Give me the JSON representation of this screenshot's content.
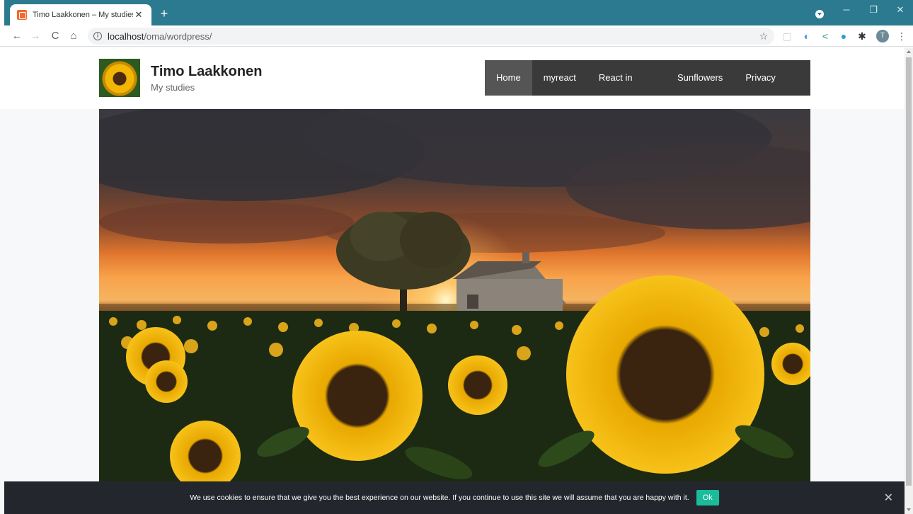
{
  "browser": {
    "tab_title": "Timo Laakkonen – My studies",
    "tab_close": "✕",
    "new_tab": "+",
    "url_host": "localhost",
    "url_path": "/oma/wordpress/",
    "profile_initial": "T",
    "window_controls": {
      "minimize": "─",
      "restore": "❐",
      "close": "✕"
    },
    "nav": {
      "back": "←",
      "forward": "→",
      "reload": "C",
      "home": "⌂"
    },
    "extensions": [
      "star-icon",
      "extension-box-icon",
      "cloud-icon",
      "share-icon",
      "telegram-icon",
      "puzzle-icon"
    ]
  },
  "site": {
    "title": "Timo Laakkonen",
    "description": "My studies",
    "nav": [
      "Home",
      "myreact",
      "React in frame",
      "Sunflowers",
      "Privacy Policy"
    ],
    "active_nav": "Home"
  },
  "cookie": {
    "text": "We use cookies to ensure that we give you the best experience on our website. If you continue to use this site we will assume that you are happy with it.",
    "ok_label": "Ok",
    "close": "✕"
  }
}
